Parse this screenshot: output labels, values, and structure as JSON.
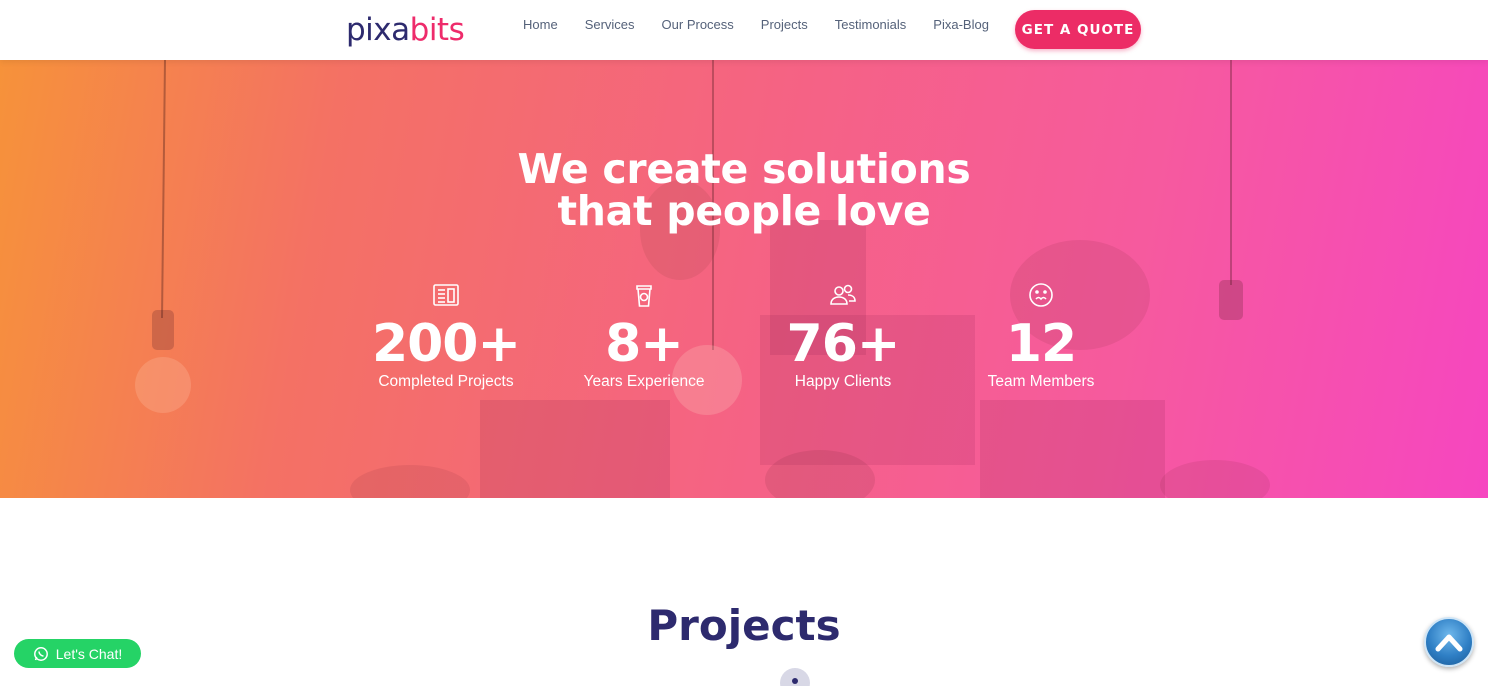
{
  "header": {
    "logo_part1": "pixa",
    "logo_part2": "bits",
    "nav": [
      "Home",
      "Services",
      "Our Process",
      "Projects",
      "Testimonials",
      "Pixa-Blog"
    ],
    "cta": "GET A QUOTE"
  },
  "hero": {
    "title_line1": "We create solutions",
    "title_line2": "that people love",
    "stats": [
      {
        "icon": "newspaper-icon",
        "number": "200+",
        "label": "Completed Projects"
      },
      {
        "icon": "cup-icon",
        "number": "8+",
        "label": "Years Experience"
      },
      {
        "icon": "users-icon",
        "number": "76+",
        "label": "Happy Clients"
      },
      {
        "icon": "face-icon",
        "number": "12",
        "label": "Team Members"
      }
    ]
  },
  "projects": {
    "title": "Projects"
  },
  "chat": {
    "label": "Let's Chat!"
  },
  "colors": {
    "brand_dark": "#2d2a6e",
    "brand_pink": "#ec2c66",
    "whatsapp": "#25d366",
    "hero_start": "#f6923a",
    "hero_end": "#f646c0"
  },
  "icons": {
    "chat": "whatsapp-icon",
    "scroll": "chevron-up-icon"
  }
}
